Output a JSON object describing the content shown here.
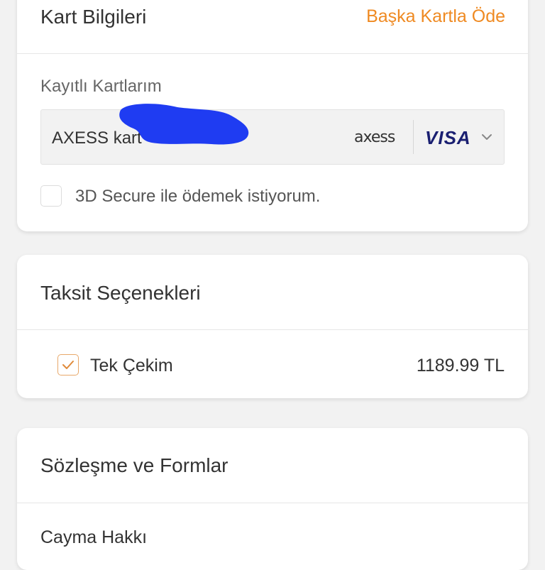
{
  "card_info": {
    "title": "Kart Bilgileri",
    "alt_card_link": "Başka Kartla Öde",
    "saved_cards_label": "Kayıtlı Kartlarım",
    "selected_card": {
      "name": "AXESS kart",
      "bank_brand": "axess",
      "network_brand": "VISA"
    },
    "secure_3d": {
      "label": "3D Secure ile ödemek istiyorum.",
      "checked": false
    }
  },
  "installments": {
    "title": "Taksit Seçenekleri",
    "options": [
      {
        "label": "Tek Çekim",
        "amount": "1189.99 TL",
        "selected": true
      }
    ]
  },
  "agreements": {
    "title": "Sözleşme ve Formlar",
    "items": [
      {
        "label": "Cayma Hakkı"
      }
    ]
  },
  "colors": {
    "accent": "#ef8a22",
    "visa_blue": "#1a1f71",
    "redaction_blue": "#1f3cf2",
    "background": "#f2f2f2"
  }
}
